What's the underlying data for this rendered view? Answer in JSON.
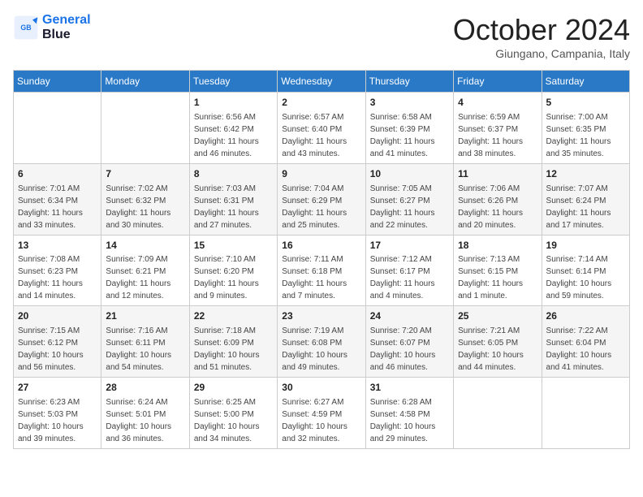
{
  "header": {
    "logo_line1": "General",
    "logo_line2": "Blue",
    "month_title": "October 2024",
    "location": "Giungano, Campania, Italy"
  },
  "weekdays": [
    "Sunday",
    "Monday",
    "Tuesday",
    "Wednesday",
    "Thursday",
    "Friday",
    "Saturday"
  ],
  "weeks": [
    [
      {
        "day": "",
        "sunrise": "",
        "sunset": "",
        "daylight": ""
      },
      {
        "day": "",
        "sunrise": "",
        "sunset": "",
        "daylight": ""
      },
      {
        "day": "1",
        "sunrise": "Sunrise: 6:56 AM",
        "sunset": "Sunset: 6:42 PM",
        "daylight": "Daylight: 11 hours and 46 minutes."
      },
      {
        "day": "2",
        "sunrise": "Sunrise: 6:57 AM",
        "sunset": "Sunset: 6:40 PM",
        "daylight": "Daylight: 11 hours and 43 minutes."
      },
      {
        "day": "3",
        "sunrise": "Sunrise: 6:58 AM",
        "sunset": "Sunset: 6:39 PM",
        "daylight": "Daylight: 11 hours and 41 minutes."
      },
      {
        "day": "4",
        "sunrise": "Sunrise: 6:59 AM",
        "sunset": "Sunset: 6:37 PM",
        "daylight": "Daylight: 11 hours and 38 minutes."
      },
      {
        "day": "5",
        "sunrise": "Sunrise: 7:00 AM",
        "sunset": "Sunset: 6:35 PM",
        "daylight": "Daylight: 11 hours and 35 minutes."
      }
    ],
    [
      {
        "day": "6",
        "sunrise": "Sunrise: 7:01 AM",
        "sunset": "Sunset: 6:34 PM",
        "daylight": "Daylight: 11 hours and 33 minutes."
      },
      {
        "day": "7",
        "sunrise": "Sunrise: 7:02 AM",
        "sunset": "Sunset: 6:32 PM",
        "daylight": "Daylight: 11 hours and 30 minutes."
      },
      {
        "day": "8",
        "sunrise": "Sunrise: 7:03 AM",
        "sunset": "Sunset: 6:31 PM",
        "daylight": "Daylight: 11 hours and 27 minutes."
      },
      {
        "day": "9",
        "sunrise": "Sunrise: 7:04 AM",
        "sunset": "Sunset: 6:29 PM",
        "daylight": "Daylight: 11 hours and 25 minutes."
      },
      {
        "day": "10",
        "sunrise": "Sunrise: 7:05 AM",
        "sunset": "Sunset: 6:27 PM",
        "daylight": "Daylight: 11 hours and 22 minutes."
      },
      {
        "day": "11",
        "sunrise": "Sunrise: 7:06 AM",
        "sunset": "Sunset: 6:26 PM",
        "daylight": "Daylight: 11 hours and 20 minutes."
      },
      {
        "day": "12",
        "sunrise": "Sunrise: 7:07 AM",
        "sunset": "Sunset: 6:24 PM",
        "daylight": "Daylight: 11 hours and 17 minutes."
      }
    ],
    [
      {
        "day": "13",
        "sunrise": "Sunrise: 7:08 AM",
        "sunset": "Sunset: 6:23 PM",
        "daylight": "Daylight: 11 hours and 14 minutes."
      },
      {
        "day": "14",
        "sunrise": "Sunrise: 7:09 AM",
        "sunset": "Sunset: 6:21 PM",
        "daylight": "Daylight: 11 hours and 12 minutes."
      },
      {
        "day": "15",
        "sunrise": "Sunrise: 7:10 AM",
        "sunset": "Sunset: 6:20 PM",
        "daylight": "Daylight: 11 hours and 9 minutes."
      },
      {
        "day": "16",
        "sunrise": "Sunrise: 7:11 AM",
        "sunset": "Sunset: 6:18 PM",
        "daylight": "Daylight: 11 hours and 7 minutes."
      },
      {
        "day": "17",
        "sunrise": "Sunrise: 7:12 AM",
        "sunset": "Sunset: 6:17 PM",
        "daylight": "Daylight: 11 hours and 4 minutes."
      },
      {
        "day": "18",
        "sunrise": "Sunrise: 7:13 AM",
        "sunset": "Sunset: 6:15 PM",
        "daylight": "Daylight: 11 hours and 1 minute."
      },
      {
        "day": "19",
        "sunrise": "Sunrise: 7:14 AM",
        "sunset": "Sunset: 6:14 PM",
        "daylight": "Daylight: 10 hours and 59 minutes."
      }
    ],
    [
      {
        "day": "20",
        "sunrise": "Sunrise: 7:15 AM",
        "sunset": "Sunset: 6:12 PM",
        "daylight": "Daylight: 10 hours and 56 minutes."
      },
      {
        "day": "21",
        "sunrise": "Sunrise: 7:16 AM",
        "sunset": "Sunset: 6:11 PM",
        "daylight": "Daylight: 10 hours and 54 minutes."
      },
      {
        "day": "22",
        "sunrise": "Sunrise: 7:18 AM",
        "sunset": "Sunset: 6:09 PM",
        "daylight": "Daylight: 10 hours and 51 minutes."
      },
      {
        "day": "23",
        "sunrise": "Sunrise: 7:19 AM",
        "sunset": "Sunset: 6:08 PM",
        "daylight": "Daylight: 10 hours and 49 minutes."
      },
      {
        "day": "24",
        "sunrise": "Sunrise: 7:20 AM",
        "sunset": "Sunset: 6:07 PM",
        "daylight": "Daylight: 10 hours and 46 minutes."
      },
      {
        "day": "25",
        "sunrise": "Sunrise: 7:21 AM",
        "sunset": "Sunset: 6:05 PM",
        "daylight": "Daylight: 10 hours and 44 minutes."
      },
      {
        "day": "26",
        "sunrise": "Sunrise: 7:22 AM",
        "sunset": "Sunset: 6:04 PM",
        "daylight": "Daylight: 10 hours and 41 minutes."
      }
    ],
    [
      {
        "day": "27",
        "sunrise": "Sunrise: 6:23 AM",
        "sunset": "Sunset: 5:03 PM",
        "daylight": "Daylight: 10 hours and 39 minutes."
      },
      {
        "day": "28",
        "sunrise": "Sunrise: 6:24 AM",
        "sunset": "Sunset: 5:01 PM",
        "daylight": "Daylight: 10 hours and 36 minutes."
      },
      {
        "day": "29",
        "sunrise": "Sunrise: 6:25 AM",
        "sunset": "Sunset: 5:00 PM",
        "daylight": "Daylight: 10 hours and 34 minutes."
      },
      {
        "day": "30",
        "sunrise": "Sunrise: 6:27 AM",
        "sunset": "Sunset: 4:59 PM",
        "daylight": "Daylight: 10 hours and 32 minutes."
      },
      {
        "day": "31",
        "sunrise": "Sunrise: 6:28 AM",
        "sunset": "Sunset: 4:58 PM",
        "daylight": "Daylight: 10 hours and 29 minutes."
      },
      {
        "day": "",
        "sunrise": "",
        "sunset": "",
        "daylight": ""
      },
      {
        "day": "",
        "sunrise": "",
        "sunset": "",
        "daylight": ""
      }
    ]
  ]
}
